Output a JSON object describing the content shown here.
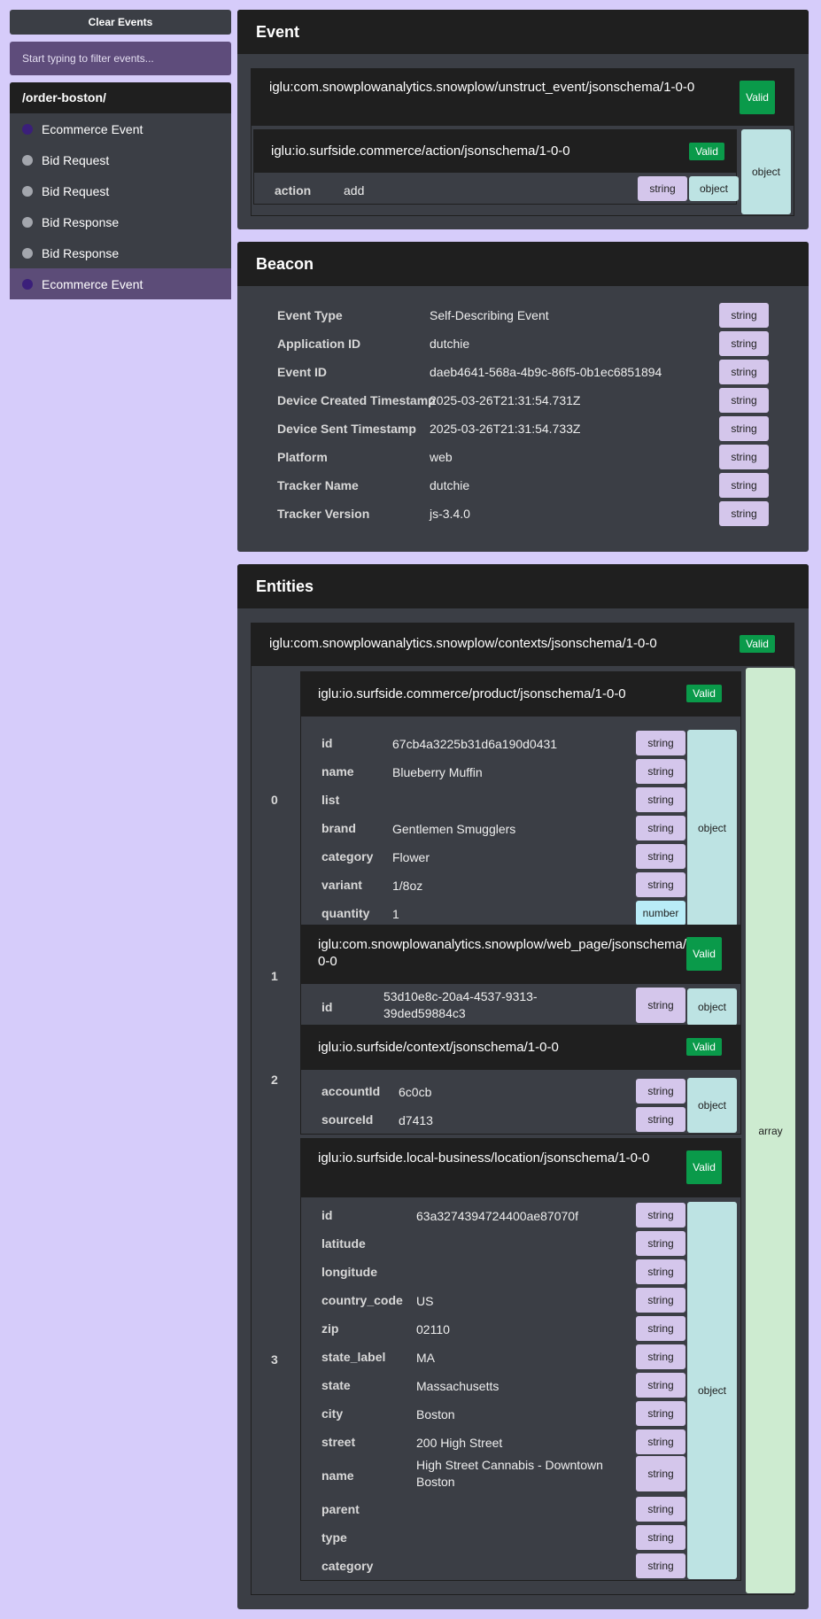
{
  "sidebar": {
    "clear_label": "Clear Events",
    "filter_placeholder": "Start typing to filter events...",
    "group_title": "/order-boston/",
    "items": [
      {
        "label": "Ecommerce Event"
      },
      {
        "label": "Bid Request"
      },
      {
        "label": "Bid Request"
      },
      {
        "label": "Bid Response"
      },
      {
        "label": "Bid Response"
      },
      {
        "label": "Ecommerce Event"
      }
    ]
  },
  "event": {
    "title": "Event",
    "schema": "iglu:com.snowplowanalytics.snowplow/unstruct_event/jsonschema/1-0-0",
    "valid": "Valid",
    "inner_schema": "iglu:io.surfside.commerce/action/jsonschema/1-0-0",
    "inner_valid": "Valid",
    "field_key": "action",
    "field_value": "add",
    "field_type": "string",
    "object_label": "object",
    "outer_object_label": "object"
  },
  "beacon": {
    "title": "Beacon",
    "rows": [
      {
        "key": "Event Type",
        "value": "Self-Describing Event",
        "type": "string"
      },
      {
        "key": "Application ID",
        "value": "dutchie",
        "type": "string"
      },
      {
        "key": "Event ID",
        "value": "daeb4641-568a-4b9c-86f5-0b1ec6851894",
        "type": "string"
      },
      {
        "key": "Device Created Timestamp",
        "value": "2025-03-26T21:31:54.731Z",
        "type": "string"
      },
      {
        "key": "Device Sent Timestamp",
        "value": "2025-03-26T21:31:54.733Z",
        "type": "string"
      },
      {
        "key": "Platform",
        "value": "web",
        "type": "string"
      },
      {
        "key": "Tracker Name",
        "value": "dutchie",
        "type": "string"
      },
      {
        "key": "Tracker Version",
        "value": "js-3.4.0",
        "type": "string"
      }
    ]
  },
  "entities": {
    "title": "Entities",
    "schema": "iglu:com.snowplowanalytics.snowplow/contexts/jsonschema/1-0-0",
    "valid": "Valid",
    "array_label": "array",
    "items": [
      {
        "index": "0",
        "schema": "iglu:io.surfside.commerce/product/jsonschema/1-0-0",
        "valid": "Valid",
        "object_label": "object",
        "rows": [
          {
            "key": "id",
            "value": "67cb4a3225b31d6a190d0431",
            "type": "string"
          },
          {
            "key": "name",
            "value": "Blueberry Muffin",
            "type": "string"
          },
          {
            "key": "list",
            "value": "",
            "type": "string"
          },
          {
            "key": "brand",
            "value": "Gentlemen Smugglers",
            "type": "string"
          },
          {
            "key": "category",
            "value": "Flower",
            "type": "string"
          },
          {
            "key": "variant",
            "value": "1/8oz",
            "type": "string"
          },
          {
            "key": "quantity",
            "value": "1",
            "type": "number"
          }
        ]
      },
      {
        "index": "1",
        "schema": "iglu:com.snowplowanalytics.snowplow/web_page/jsonschema/1-0-0",
        "valid": "Valid",
        "object_label": "object",
        "rows": [
          {
            "key": "id",
            "value": "53d10e8c-20a4-4537-9313-39ded59884c3",
            "type": "string"
          }
        ]
      },
      {
        "index": "2",
        "schema": "iglu:io.surfside/context/jsonschema/1-0-0",
        "valid": "Valid",
        "object_label": "object",
        "rows": [
          {
            "key": "accountId",
            "value": "6c0cb",
            "type": "string"
          },
          {
            "key": "sourceId",
            "value": "d7413",
            "type": "string"
          }
        ]
      },
      {
        "index": "3",
        "schema": "iglu:io.surfside.local-business/location/jsonschema/1-0-0",
        "valid": "Valid",
        "object_label": "object",
        "rows": [
          {
            "key": "id",
            "value": "63a3274394724400ae87070f",
            "type": "string"
          },
          {
            "key": "latitude",
            "value": "",
            "type": "string"
          },
          {
            "key": "longitude",
            "value": "",
            "type": "string"
          },
          {
            "key": "country_code",
            "value": "US",
            "type": "string"
          },
          {
            "key": "zip",
            "value": "02110",
            "type": "string"
          },
          {
            "key": "state_label",
            "value": "MA",
            "type": "string"
          },
          {
            "key": "state",
            "value": "Massachusetts",
            "type": "string"
          },
          {
            "key": "city",
            "value": "Boston",
            "type": "string"
          },
          {
            "key": "street",
            "value": "200 High Street",
            "type": "string"
          },
          {
            "key": "name",
            "value": "High Street Cannabis - Downtown Boston",
            "type": "string"
          },
          {
            "key": "parent",
            "value": "",
            "type": "string"
          },
          {
            "key": "type",
            "value": "",
            "type": "string"
          },
          {
            "key": "category",
            "value": "",
            "type": "string"
          }
        ]
      }
    ]
  }
}
